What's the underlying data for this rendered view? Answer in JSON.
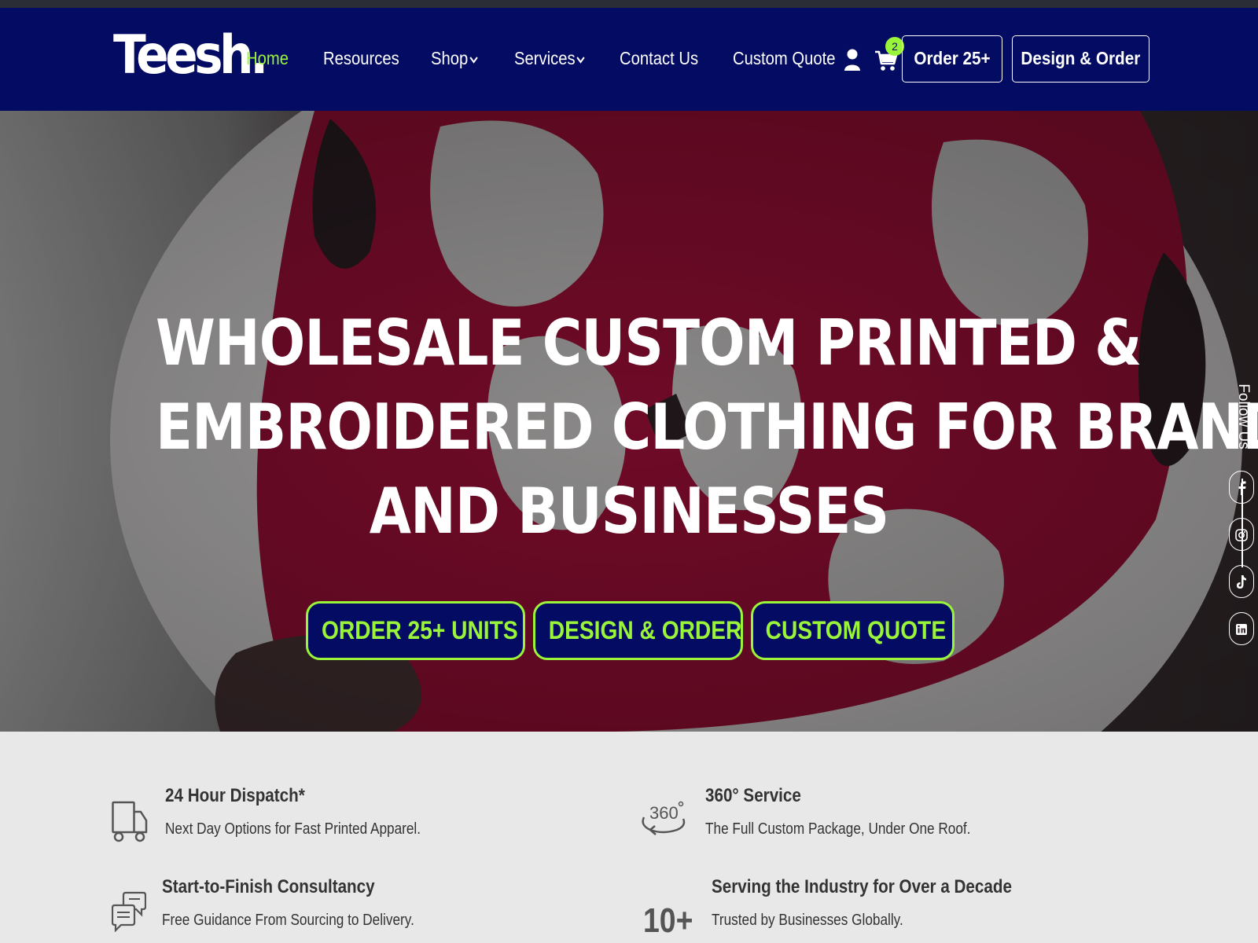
{
  "nav": {
    "logo": "Teesh.",
    "links": [
      {
        "label": "Home",
        "active": true
      },
      {
        "label": "Resources"
      },
      {
        "label": "Shop",
        "dropdown": true
      },
      {
        "label": "Services",
        "dropdown": true
      },
      {
        "label": "Contact Us"
      },
      {
        "label": "Custom Quote"
      }
    ],
    "cart_count": "2",
    "buttons": [
      "Order 25+",
      "Design & Order"
    ],
    "icons": [
      "user-icon",
      "cart-icon"
    ]
  },
  "hero": {
    "title_lines": [
      "WHOLESALE CUSTOM PRINTED &",
      "EMBROIDERED CLOTHING FOR BRANDS",
      "AND BUSINESSES"
    ],
    "buttons": [
      "ORDER 25+ UNITS",
      "DESIGN & ORDER",
      "CUSTOM QUOTE"
    ]
  },
  "follow": {
    "label": "Follow Us",
    "socials": [
      "facebook-icon",
      "instagram-icon",
      "tiktok-icon",
      "linkedin-icon"
    ]
  },
  "features": [
    {
      "title": "24 Hour Dispatch*",
      "desc": "Next Day Options for Fast Printed Apparel.",
      "icon": "truck-icon"
    },
    {
      "title": "360° Service",
      "desc": "The Full Custom Package, Under One Roof.",
      "icon": "360-icon"
    },
    {
      "title": "Start-to-Finish Consultancy",
      "desc": "Free Guidance From Sourcing to Delivery.",
      "icon": "chat-bubbles-icon"
    },
    {
      "title": "Serving the Industry for Over a Decade",
      "desc": "Trusted by Businesses Globally.",
      "icon": "10-plus-icon",
      "badge": "10+"
    }
  ],
  "colors": {
    "navy": "#030b63",
    "accent_green": "#9af53a",
    "hero_red": "#b0123f",
    "feature_bg": "#e8e8e8"
  }
}
